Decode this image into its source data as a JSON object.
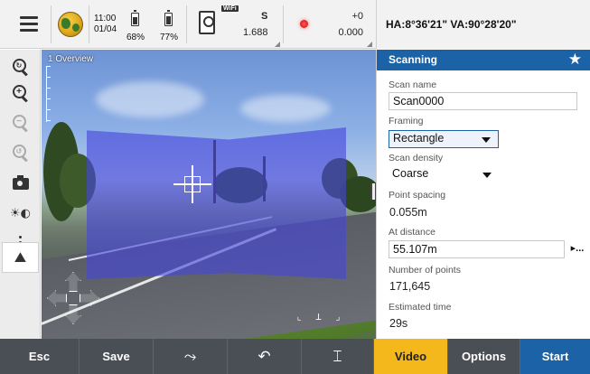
{
  "status_bar": {
    "time": "11:00",
    "date": "01/04",
    "battery_1": "68%",
    "battery_2": "77%",
    "wifi_label": "WiFi",
    "instrument_letter": "S",
    "instrument_value": "1.688",
    "plus_value": "+0",
    "minus_value": "0.000",
    "angles": "HA:8°36'21\"  VA:90°28'20\""
  },
  "viewport": {
    "overview_label": "1 Overview",
    "scan_area_color": "#4646dc"
  },
  "left_tools": [
    {
      "name": "zoom-extents",
      "icon": "zoom-extents-icon",
      "symbol": "⟲",
      "enabled": true
    },
    {
      "name": "zoom-in",
      "icon": "zoom-in-icon",
      "symbol": "+",
      "enabled": true
    },
    {
      "name": "zoom-out",
      "icon": "zoom-out-icon",
      "symbol": "−",
      "enabled": false
    },
    {
      "name": "zoom-previous",
      "icon": "zoom-previous-icon",
      "symbol": "⟲",
      "enabled": false
    },
    {
      "name": "camera",
      "icon": "camera-icon",
      "symbol": "",
      "enabled": true
    },
    {
      "name": "brightness",
      "icon": "brightness-icon",
      "symbol": "☀◐",
      "enabled": true
    },
    {
      "name": "more",
      "icon": "more-vertical-icon",
      "symbol": "",
      "enabled": true
    },
    {
      "name": "map-view",
      "icon": "map-pin-icon",
      "symbol": "⛰",
      "enabled": true
    }
  ],
  "panel": {
    "title": "Scanning",
    "scan_name_label": "Scan name",
    "scan_name_value": "Scan0000",
    "framing_label": "Framing",
    "framing_value": "Rectangle",
    "scan_density_label": "Scan density",
    "scan_density_value": "Coarse",
    "point_spacing_label": "Point spacing",
    "point_spacing_value": "0.055m",
    "at_distance_label": "At distance",
    "at_distance_value": "55.107m",
    "at_distance_more": "▸...",
    "number_of_points_label": "Number of points",
    "number_of_points_value": "171,645",
    "estimated_time_label": "Estimated time",
    "estimated_time_value": "29s"
  },
  "bottom_bar": {
    "esc": "Esc",
    "save": "Save",
    "video": "Video",
    "options": "Options",
    "start": "Start"
  },
  "colors": {
    "accent_blue": "#1c62a6",
    "video_yellow": "#f5b81c",
    "bottom_bar": "#4a4f56"
  }
}
